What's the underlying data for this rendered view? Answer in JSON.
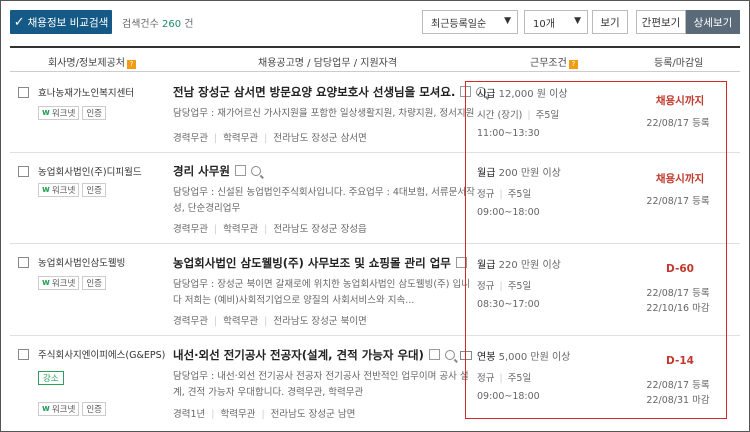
{
  "toolbar": {
    "compare_label": "채용정보 비교검색",
    "count_label": "검색건수",
    "count_value": "260",
    "count_unit": "건",
    "sort_selected": "최근등록일순",
    "per_page_selected": "10개",
    "view_label": "보기",
    "simple_view_label": "간편보기",
    "detail_view_label": "상세보기"
  },
  "table": {
    "headers": {
      "company": "회사명/정보제공처",
      "job": "채용공고명 / 담당업무 / 지원자격",
      "conditions": "근무조건",
      "deadline": "등록/마감일"
    },
    "rows": [
      {
        "company": "효나농재가노인복지센터",
        "badges": [
          "워크넷",
          "인증"
        ],
        "extra_badge": "",
        "title": "전남 장성군 삼서면 방문요양 요양보호사 선생님을 모셔요.",
        "desc": "담당업무 : 재가어르신 가사지원을 포함한 일상생활지원, 차량지원, 정서지원 등",
        "career": "경력무관",
        "education": "학력무관",
        "location": "전라남도 장성군 삼서면",
        "pay_type": "시급",
        "pay_amount": "12,000 원 이상",
        "employment": "시간 (장기)",
        "days": "주5일",
        "hours": "11:00~13:30",
        "deadline": "채용시까지",
        "reg_date": "22/08/17 등록",
        "close_date": ""
      },
      {
        "company": "농업회사법인(주)디피월드",
        "badges": [
          "워크넷",
          "인증"
        ],
        "extra_badge": "",
        "title": "경리 사무원",
        "desc": "담당업무 : 신설된 농업법인주식회사입니다. 주요업무 : 4대보험, 서류문서작성, 단순경리업무",
        "career": "경력무관",
        "education": "학력무관",
        "location": "전라남도 장성군 장성읍",
        "pay_type": "월급",
        "pay_amount": "200 만원 이상",
        "employment": "정규",
        "days": "주5일",
        "hours": "09:00~18:00",
        "deadline": "채용시까지",
        "reg_date": "22/08/17 등록",
        "close_date": ""
      },
      {
        "company": "농업회사법인삼도웰빙",
        "badges": [
          "워크넷",
          "인증"
        ],
        "extra_badge": "",
        "title": "농업회사법인 삼도웰빙(주) 사무보조 및 쇼핑몰 관리 업무",
        "desc": "담당업무 : 장성군 북이면 갈재로에 위치한 농업회사법인 삼도웰빙(주) 입니다 저희는 (예비)사회적기업으로 양질의 사회서비스와 지속...",
        "career": "경력무관",
        "education": "학력무관",
        "location": "전라남도 장성군 북이면",
        "pay_type": "월급",
        "pay_amount": "220 만원 이상",
        "employment": "정규",
        "days": "주5일",
        "hours": "08:30~17:00",
        "deadline": "D-60",
        "reg_date": "22/08/17 등록",
        "close_date": "22/10/16 마감"
      },
      {
        "company": "주식회사지엔이피에스(G&EPS)",
        "badges": [
          "워크넷",
          "인증"
        ],
        "extra_badge": "강소",
        "title": "내선·외선 전기공사 전공자(설계, 견적 가능자 우대)",
        "desc": "담당업무 : 내선·외선 전기공사 전공자 전기공사 전반적인 업무이며 공사 설계, 견적 가능자 우대합니다. 경력무관, 학력무관",
        "career": "경력1년",
        "education": "학력무관",
        "location": "전라남도 장성군 남면",
        "pay_type": "연봉",
        "pay_amount": "5,000 만원 이상",
        "employment": "정규",
        "days": "주5일",
        "hours": "09:00~18:00",
        "deadline": "D-14",
        "reg_date": "22/08/17 등록",
        "close_date": "22/08/31 마감"
      }
    ]
  }
}
